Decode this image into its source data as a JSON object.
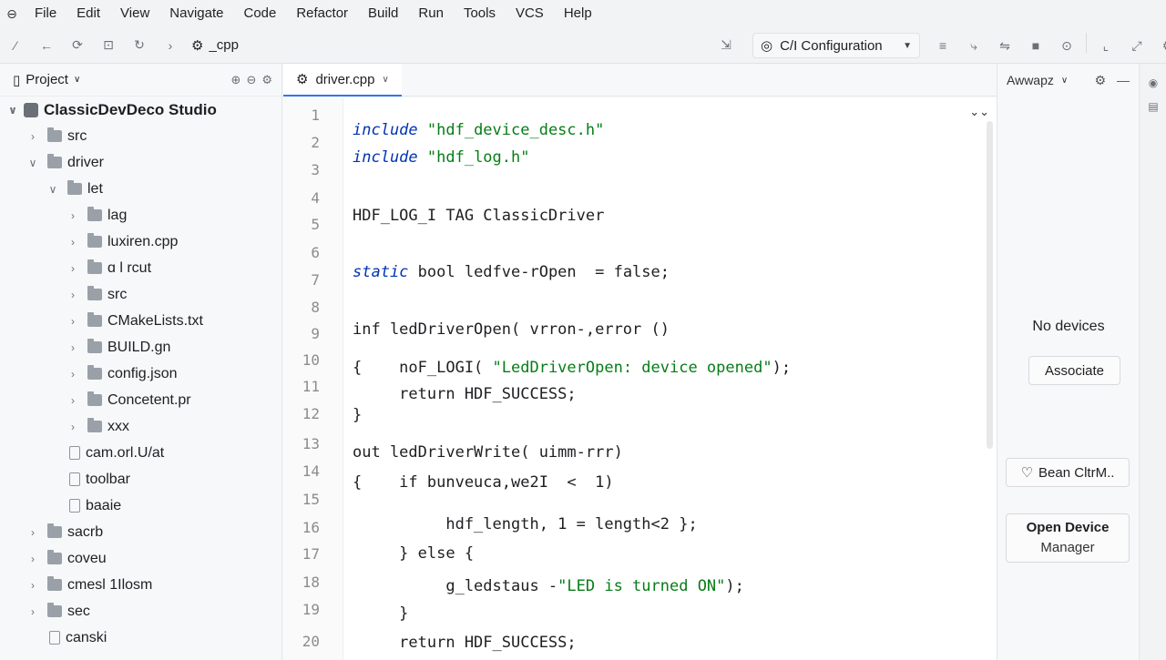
{
  "menubar": {
    "items": [
      "File",
      "Edit",
      "View",
      "Navigate",
      "Code",
      "Refactor",
      "Build",
      "Run",
      "Tools",
      "VCS",
      "Help"
    ]
  },
  "toolbar": {
    "project_name": "_cpp",
    "run_config": "C/I Configuration"
  },
  "project_panel": {
    "title": "Project",
    "tree": [
      {
        "label": "ClassicDevDeco Studio",
        "depth": 0,
        "type": "root",
        "expanded": true
      },
      {
        "label": "src",
        "depth": 1,
        "type": "folder",
        "expanded": false
      },
      {
        "label": "driver",
        "depth": 1,
        "type": "folder",
        "expanded": true
      },
      {
        "label": "let",
        "depth": 2,
        "type": "folder",
        "expanded": true
      },
      {
        "label": "lag",
        "depth": 3,
        "type": "folder",
        "expanded": false
      },
      {
        "label": "luxiren.cpp",
        "depth": 3,
        "type": "folder",
        "expanded": false
      },
      {
        "label": "ɑ l  rcut",
        "depth": 3,
        "type": "folder",
        "expanded": false
      },
      {
        "label": "src",
        "depth": 3,
        "type": "folder",
        "expanded": false
      },
      {
        "label": "CMakeLists.txt",
        "depth": 3,
        "type": "folder",
        "expanded": false
      },
      {
        "label": "BUILD.gn",
        "depth": 3,
        "type": "folder",
        "expanded": false
      },
      {
        "label": "config.json",
        "depth": 3,
        "type": "folder",
        "expanded": false
      },
      {
        "label": "Concetent.pr",
        "depth": 3,
        "type": "folder",
        "expanded": false
      },
      {
        "label": "xxx",
        "depth": 3,
        "type": "folder",
        "expanded": false
      },
      {
        "label": "cam.orl.U/at",
        "depth": 2,
        "type": "file"
      },
      {
        "label": "toolbar",
        "depth": 2,
        "type": "file"
      },
      {
        "label": "baaie",
        "depth": 2,
        "type": "file"
      },
      {
        "label": "sacrb",
        "depth": 1,
        "type": "folder",
        "expanded": false
      },
      {
        "label": "coveu",
        "depth": 1,
        "type": "folder",
        "expanded": false
      },
      {
        "label": "cmesl 1Ilosm",
        "depth": 1,
        "type": "folder",
        "expanded": false
      },
      {
        "label": "sec",
        "depth": 1,
        "type": "folder",
        "expanded": false
      },
      {
        "label": "canski",
        "depth": 1,
        "type": "file"
      }
    ]
  },
  "editor": {
    "tab_label": "driver.cpp",
    "lines": [
      {
        "n": "1",
        "segs": []
      },
      {
        "n": "2",
        "segs": [
          {
            "t": "include",
            "c": "kw"
          },
          {
            "t": " \"hdf_device_desc.h\"",
            "c": "str"
          }
        ]
      },
      {
        "n": "3",
        "segs": [
          {
            "t": "include",
            "c": "kw"
          },
          {
            "t": " \"hdf_log.h\"",
            "c": "str"
          }
        ]
      },
      {
        "n": "4",
        "segs": []
      },
      {
        "n": "5",
        "segs": [
          {
            "t": "HDF_LOG_I TAG ClassicDriver",
            "c": ""
          }
        ]
      },
      {
        "n": "6",
        "segs": []
      },
      {
        "n": "7",
        "segs": [
          {
            "t": "static",
            "c": "kw"
          },
          {
            "t": " bool ledfve-rOpen  = false;",
            "c": ""
          }
        ]
      },
      {
        "n": "8",
        "segs": []
      },
      {
        "n": "9",
        "segs": [
          {
            "t": "inf ledDriverOpen( vrron-,error ()",
            "c": ""
          }
        ]
      },
      {
        "n": "10",
        "segs": [
          {
            "t": "{    noF_LOGI( ",
            "c": ""
          },
          {
            "t": "\"LedDriverOpen: device opened\"",
            "c": "str"
          },
          {
            "t": ");",
            "c": ""
          }
        ]
      },
      {
        "n": "11",
        "segs": [
          {
            "t": "     return HDF_SUCCESS;",
            "c": ""
          }
        ]
      },
      {
        "n": "12",
        "segs": [
          {
            "t": "}",
            "c": ""
          }
        ]
      },
      {
        "n": "13",
        "segs": [
          {
            "t": "out ledDriverWrite( uimm-rrr)",
            "c": ""
          }
        ]
      },
      {
        "n": "14",
        "segs": [
          {
            "t": "{    if bunveuca,we2I  <  1)",
            "c": ""
          }
        ]
      },
      {
        "n": "15",
        "segs": []
      },
      {
        "n": "16",
        "segs": [
          {
            "t": "          hdf_length, 1 = length<2 };",
            "c": ""
          }
        ]
      },
      {
        "n": "17",
        "segs": [
          {
            "t": "     } else {",
            "c": ""
          }
        ]
      },
      {
        "n": "18",
        "segs": [
          {
            "t": "          g_ledstaus -",
            "c": ""
          },
          {
            "t": "\"LED is turned ON\"",
            "c": "str"
          },
          {
            "t": ");",
            "c": ""
          }
        ]
      },
      {
        "n": "19",
        "segs": [
          {
            "t": "     }",
            "c": ""
          }
        ]
      },
      {
        "n": "20",
        "segs": [
          {
            "t": "     return HDF_SUCCESS;",
            "c": ""
          }
        ]
      }
    ]
  },
  "device_panel": {
    "title": "Awwapz",
    "no_devices": "No devices",
    "associate_label": "Associate",
    "bean_label": "Bean CltrM..",
    "open_device_line1": "Open Device",
    "open_device_line2": "Manager"
  }
}
